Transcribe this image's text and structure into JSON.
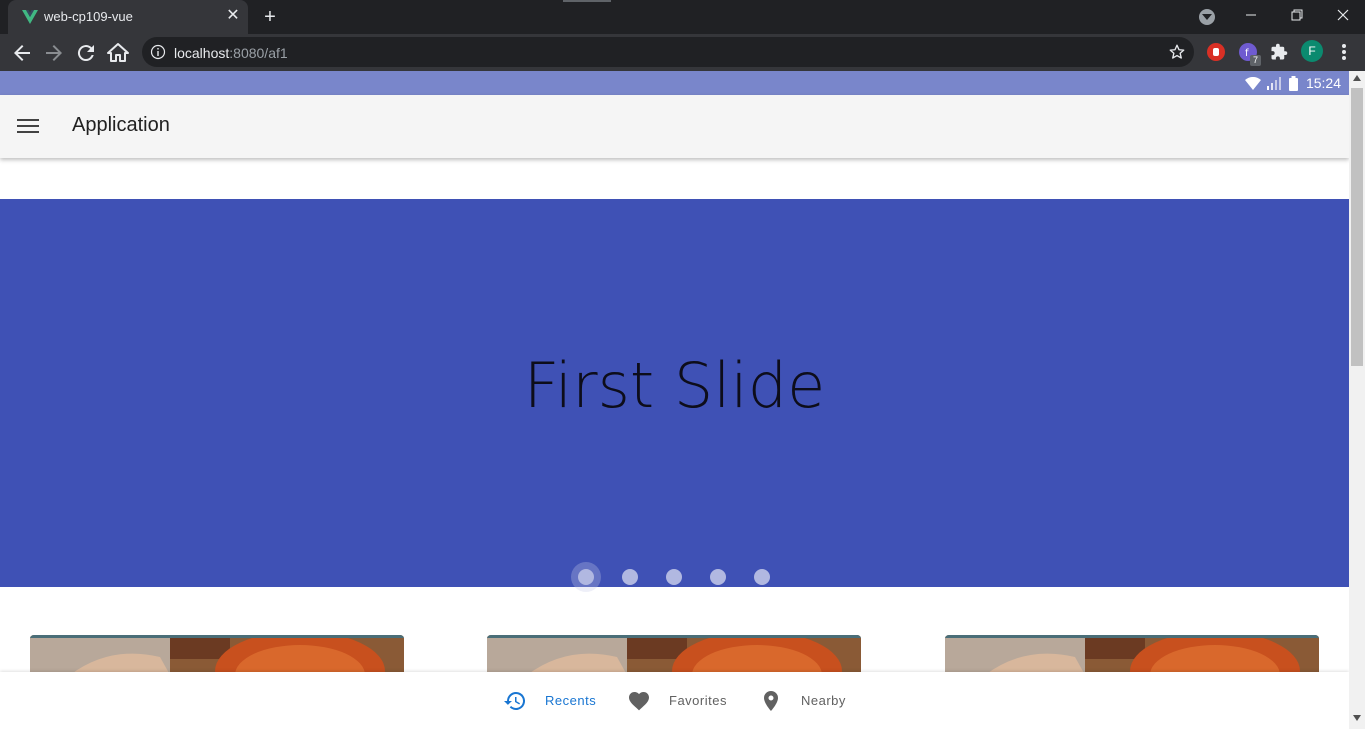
{
  "browser": {
    "tab_title": "web-cp109-vue",
    "url_host": "localhost",
    "url_rest": ":8080/af1",
    "extension_badge": "7",
    "profile_initial": "F"
  },
  "device": {
    "time": "15:24"
  },
  "app": {
    "title": "Application"
  },
  "carousel": {
    "slide_text": "First Slide",
    "slide_count": 5,
    "active_index": 0,
    "background": "#3f51b5"
  },
  "bottom_nav": {
    "items": [
      {
        "label": "Recents",
        "icon": "history-icon",
        "active": true
      },
      {
        "label": "Favorites",
        "icon": "heart-icon",
        "active": false
      },
      {
        "label": "Nearby",
        "icon": "location-pin-icon",
        "active": false
      }
    ]
  },
  "colors": {
    "accent": "#1976d2",
    "status_bar": "#7986cb",
    "primary": "#3f51b5"
  }
}
